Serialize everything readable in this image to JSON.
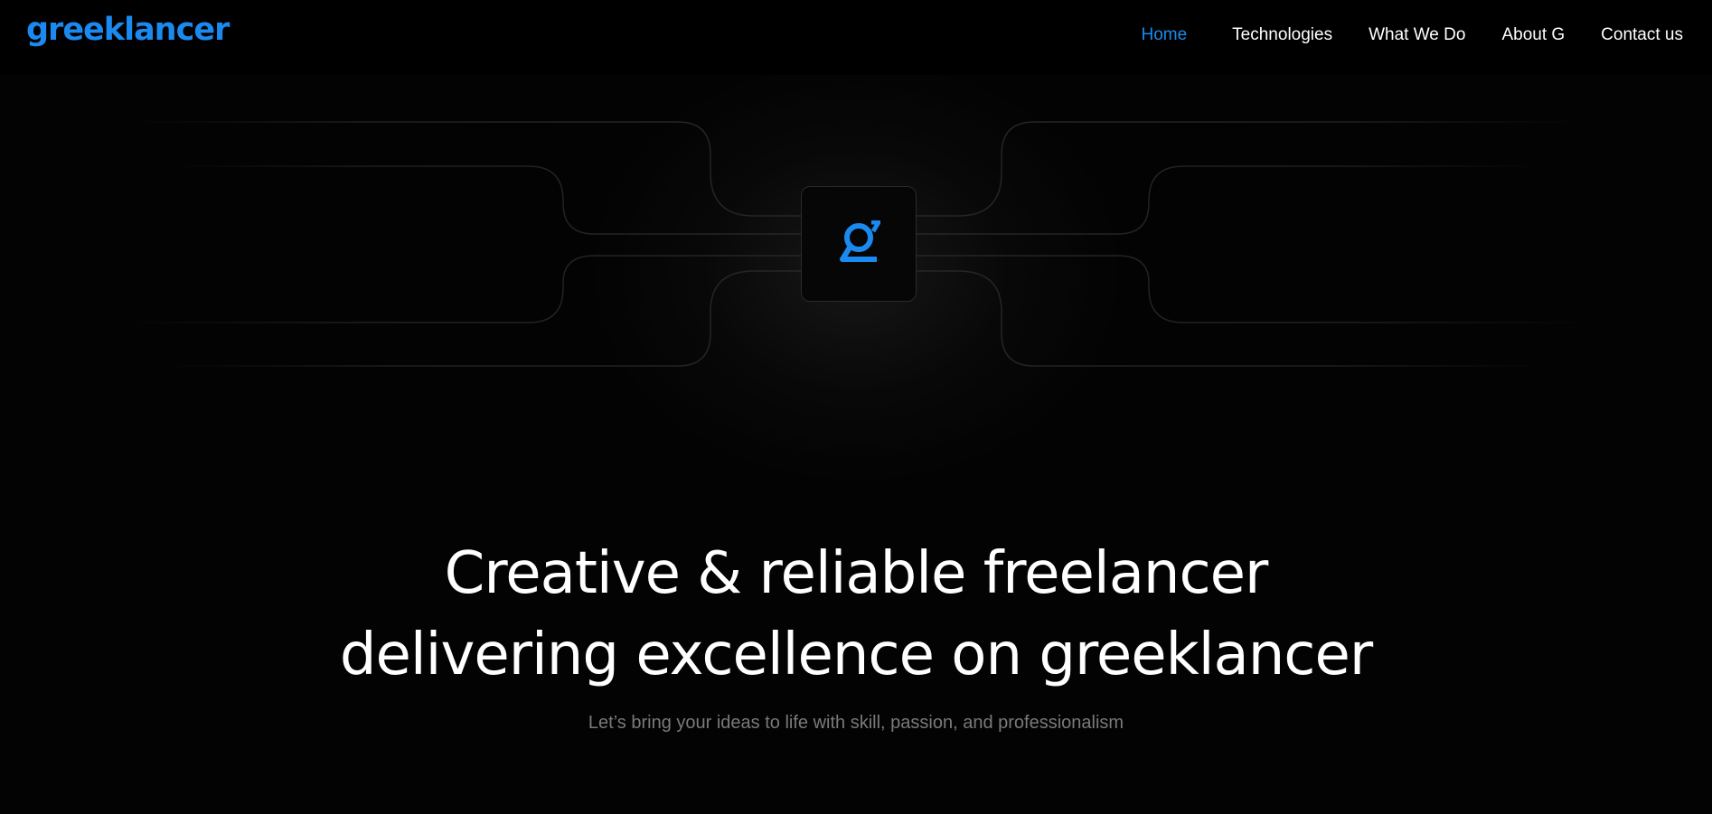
{
  "brand": {
    "logo_text": "greeklancer",
    "accent_color": "#1a8af0"
  },
  "nav": {
    "items": [
      {
        "label": "Home",
        "active": true
      },
      {
        "label": "Technologies",
        "active": false
      },
      {
        "label": "What We Do",
        "active": false
      },
      {
        "label": "About G",
        "active": false
      },
      {
        "label": "Contact us",
        "active": false
      }
    ]
  },
  "hero": {
    "tile_icon": "g-logo-icon",
    "headline_line1": "Creative & reliable freelancer",
    "headline_line2": "delivering excellence on greeklancer",
    "subtitle": "Let’s bring your ideas to life with skill, passion, and professionalism"
  }
}
